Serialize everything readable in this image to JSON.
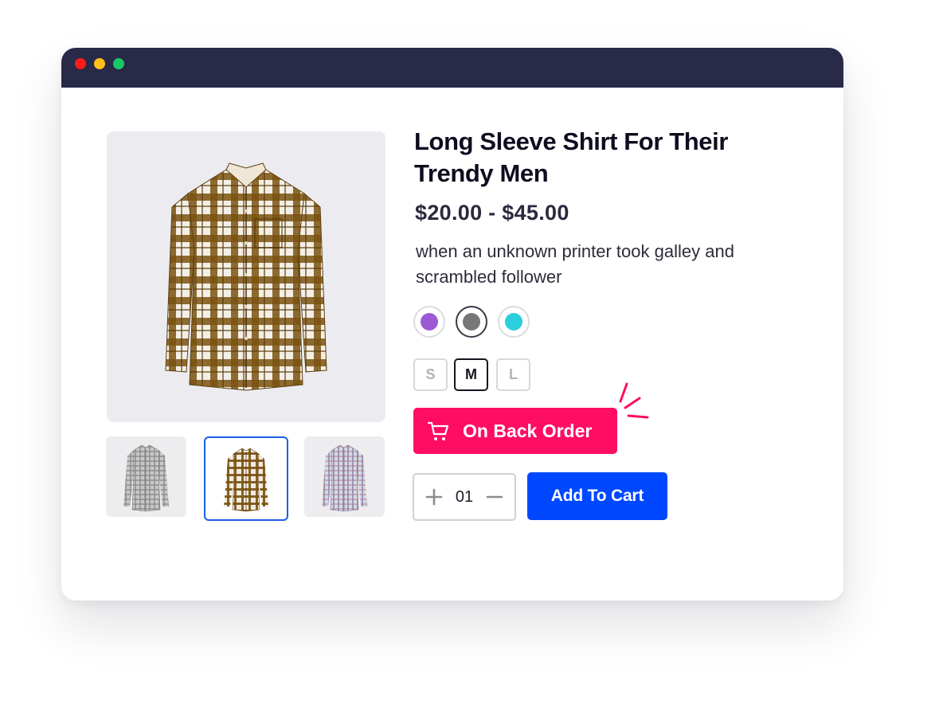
{
  "window": {
    "controls": [
      "close",
      "minimize",
      "maximize"
    ],
    "colors": {
      "titlebar": "#292948",
      "close": "#ff1a1a",
      "minimize": "#ffc01a",
      "maximize": "#17c964"
    }
  },
  "product": {
    "title": "Long Sleeve Shirt  For Their Trendy Men",
    "price": "$20.00 - $45.00",
    "description": "when an unknown printer took galley  and scrambled follower",
    "main_image_icon": "plaid-shirt-image",
    "thumbnails": [
      {
        "icon": "grey-check-shirt-thumbnail",
        "selected": false
      },
      {
        "icon": "brown-plaid-shirt-thumbnail",
        "selected": true
      },
      {
        "icon": "blue-check-shirt-thumbnail",
        "selected": false
      }
    ]
  },
  "colors": [
    {
      "name": "purple",
      "hex": "#9b59d6",
      "selected": false
    },
    {
      "name": "grey",
      "hex": "#777777",
      "selected": true
    },
    {
      "name": "cyan",
      "hex": "#2bcfdb",
      "selected": false
    }
  ],
  "sizes": [
    {
      "label": "S",
      "selected": false
    },
    {
      "label": "M",
      "selected": true
    },
    {
      "label": "L",
      "selected": false
    }
  ],
  "backorder": {
    "label": "On Back Order",
    "icon": "cart-icon",
    "color": "#ff0d62"
  },
  "quantity": {
    "value": "01",
    "increment_icon": "plus-icon",
    "decrement_icon": "minus-icon"
  },
  "add_to_cart": {
    "label": "Add To Cart",
    "color": "#0048ff"
  }
}
